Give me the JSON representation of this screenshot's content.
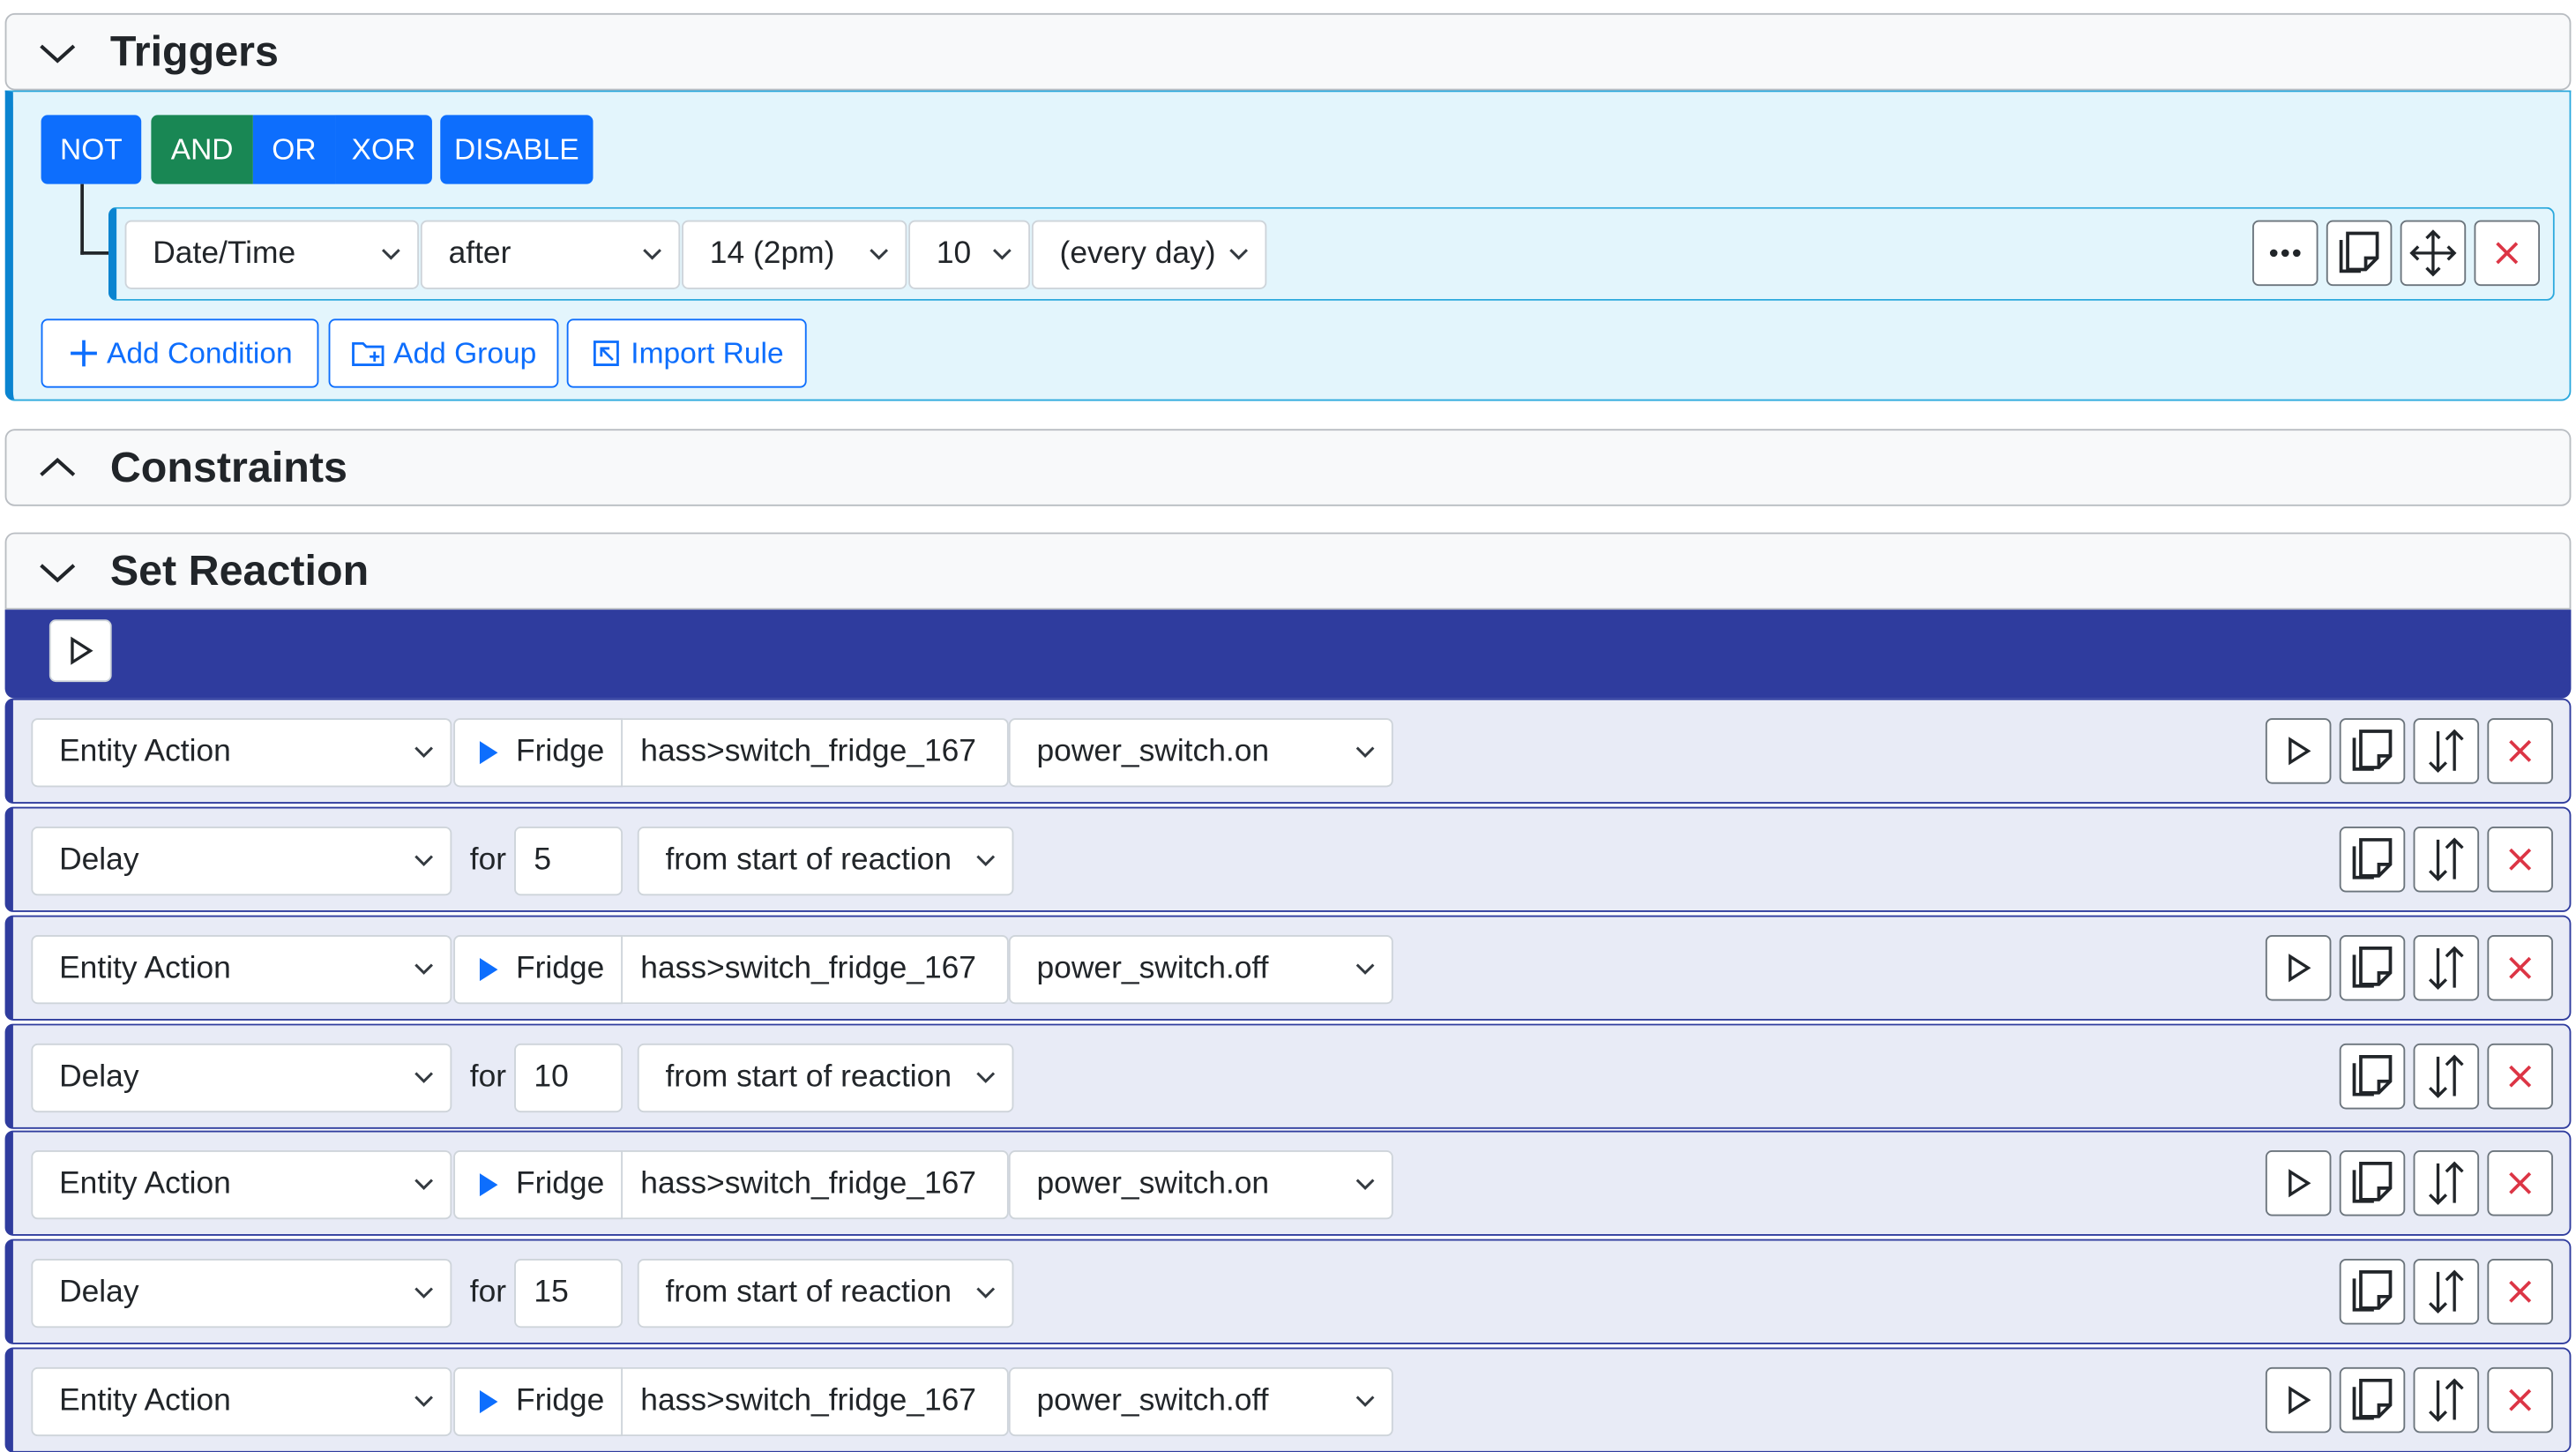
{
  "triggers": {
    "title": "Triggers",
    "logic_buttons": {
      "not": "NOT",
      "and": "AND",
      "or": "OR",
      "xor": "XOR",
      "disable": "DISABLE"
    },
    "condition": {
      "type": "Date/Time",
      "operator": "after",
      "hour": "14 (2pm)",
      "minute": "10",
      "days": "(every day)"
    },
    "add_condition": "Add Condition",
    "add_group": "Add Group",
    "import_rule": "Import Rule"
  },
  "constraints": {
    "title": "Constraints"
  },
  "reaction": {
    "title": "Set Reaction",
    "actions": [
      {
        "type": "Entity Action",
        "entity_name": "Fridge",
        "entity_id": "hass>switch_fridge_167",
        "service": "power_switch.on"
      },
      {
        "type": "Delay",
        "for_label": "for",
        "seconds": "5",
        "mode": "from start of reaction"
      },
      {
        "type": "Entity Action",
        "entity_name": "Fridge",
        "entity_id": "hass>switch_fridge_167",
        "service": "power_switch.off"
      },
      {
        "type": "Delay",
        "for_label": "for",
        "seconds": "10",
        "mode": "from start of reaction"
      },
      {
        "type": "Entity Action",
        "entity_name": "Fridge",
        "entity_id": "hass>switch_fridge_167",
        "service": "power_switch.on"
      },
      {
        "type": "Delay",
        "for_label": "for",
        "seconds": "15",
        "mode": "from start of reaction"
      },
      {
        "type": "Entity Action",
        "entity_name": "Fridge",
        "entity_id": "hass>switch_fridge_167",
        "service": "power_switch.off"
      }
    ]
  },
  "colors": {
    "primary": "#0d6efd",
    "success": "#198754",
    "danger": "#dc3545",
    "reaction_bar": "#2f3c9e",
    "trigger_bg": "#e3f5fc"
  }
}
